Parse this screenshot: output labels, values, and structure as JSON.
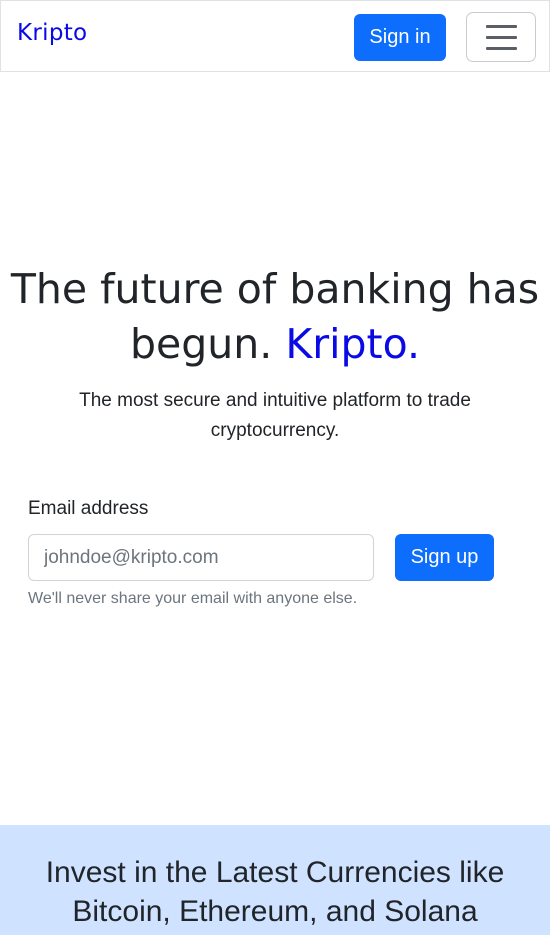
{
  "navbar": {
    "brand": "Kripto",
    "signin_label": "Sign in",
    "toggler_icon": "hamburger-menu-icon"
  },
  "hero": {
    "title_main": "The future of banking has begun.",
    "title_accent": "Kripto.",
    "subtitle": "The most secure and intuitive platform to trade cryptocurrency."
  },
  "signup_form": {
    "email_label": "Email address",
    "email_placeholder": "johndoe@kripto.com",
    "email_value": "",
    "signup_label": "Sign up",
    "help_text": "We'll never share your email with anyone else."
  },
  "invest": {
    "title": "Invest in the Latest Currencies like Bitcoin, Ethereum, and Solana"
  },
  "colors": {
    "primary": "#0d6efd",
    "brand": "#0a0ae6",
    "invest_bg": "#cfe2ff"
  }
}
